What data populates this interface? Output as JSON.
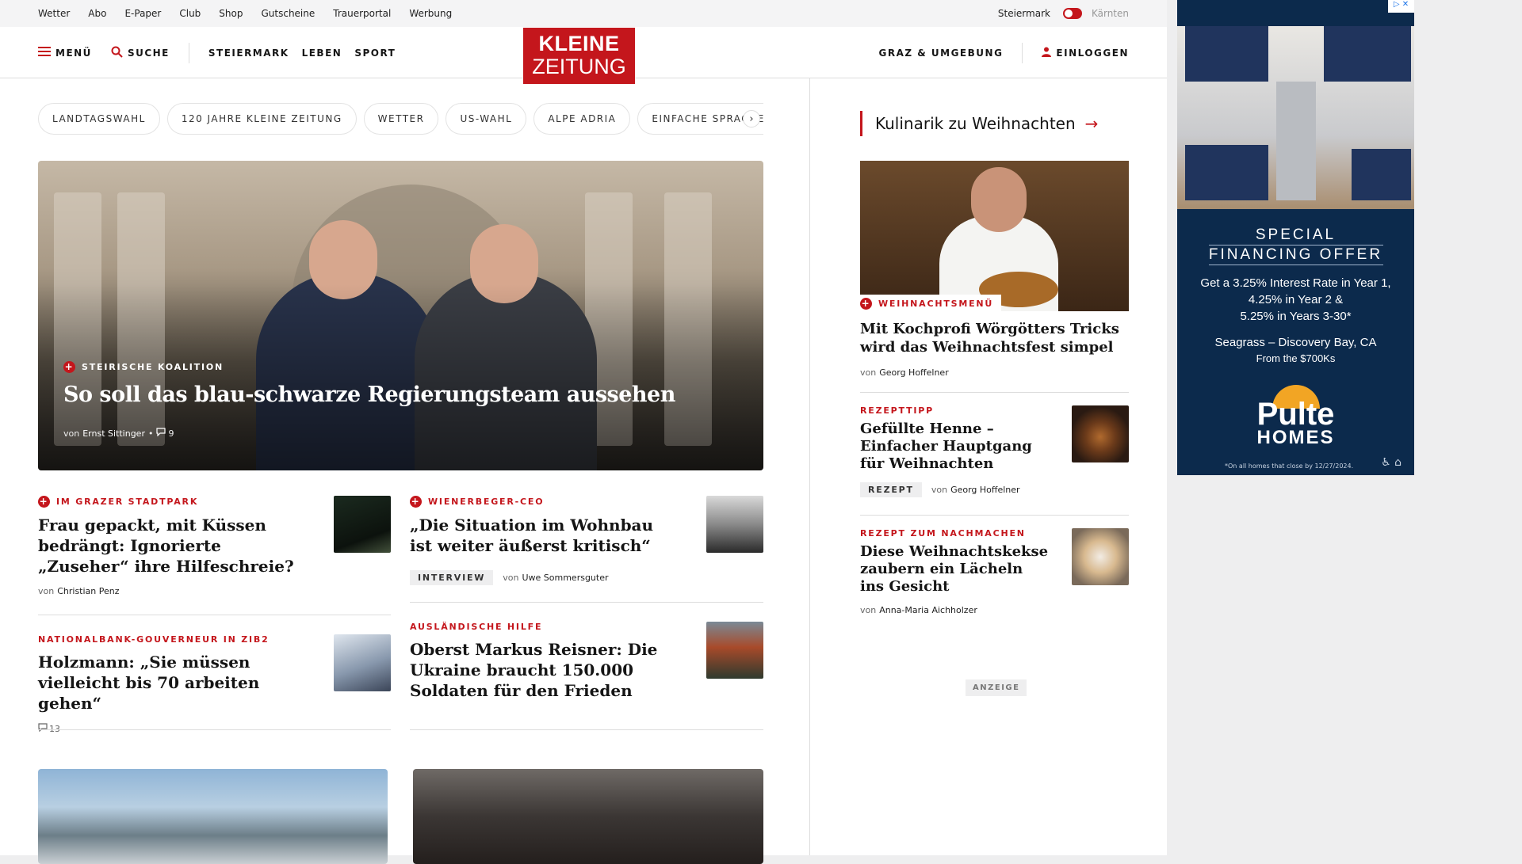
{
  "util_nav": [
    "Wetter",
    "Abo",
    "E-Paper",
    "Club",
    "Shop",
    "Gutscheine",
    "Trauerportal",
    "Werbung"
  ],
  "region": {
    "active": "Steiermark",
    "inactive": "Kärnten"
  },
  "header": {
    "menu": "MENÜ",
    "search": "SUCHE",
    "nav": [
      "STEIERMARK",
      "LEBEN",
      "SPORT"
    ],
    "logo_line1": "KLEINE",
    "logo_line2": "ZEITUNG",
    "region_link": "GRAZ & UMGEBUNG",
    "login": "EINLOGGEN"
  },
  "chips": [
    "LANDTAGSWAHL",
    "120 JAHRE KLEINE ZEITUNG",
    "WETTER",
    "US-WAHL",
    "ALPE ADRIA",
    "EINFACHE SPRACHE"
  ],
  "hero": {
    "kicker": "STEIRISCHE KOALITION",
    "title": "So soll das blau-schwarze Regierungsteam aussehen",
    "by": "von",
    "author": "Ernst Sittinger",
    "comments": "9"
  },
  "articles": [
    {
      "kicker": "IM GRAZER STADTPARK",
      "title": "Frau gepackt, mit Küssen bedrängt: Ignorierte „Zuseher“ ihre Hilfeschreie?",
      "by": "von",
      "author": "Christian Penz"
    },
    {
      "kicker": "WIENERBEGER-CEO",
      "title": "„Die Situation im Wohnbau ist weiter äußerst kritisch“",
      "tag": "INTERVIEW",
      "by": "von",
      "author": "Uwe Sommersguter"
    },
    {
      "kicker": "NATIONALBANK-GOUVERNEUR IN ZIB2",
      "title": "Holzmann: „Sie müssen vielleicht bis 70 arbeiten gehen“",
      "comments": "13"
    },
    {
      "kicker": "AUSLÄNDISCHE HILFE",
      "title": "Oberst Markus Reisner: Die Ukraine braucht 150.000 Soldaten für den Frieden"
    }
  ],
  "sidebar": {
    "section_title": "Kulinarik zu Weihnachten",
    "lead": {
      "kicker": "WEIHNACHTSMENÜ",
      "title": "Mit Kochprofi Wörgötters Tricks wird das Weihnachtsfest simpel",
      "by": "von",
      "author": "Georg Hoffelner"
    },
    "items": [
      {
        "kicker": "REZEPTTIPP",
        "title": "Gefüllte Henne – Einfacher Hauptgang für Weihnachten",
        "tag": "REZEPT",
        "by": "von",
        "author": "Georg Hoffelner"
      },
      {
        "kicker": "REZEPT ZUM NACHMACHEN",
        "title": "Diese Weihnachtskekse zaubern ein Lächeln ins Gesicht",
        "by": "von",
        "author": "Anna-Maria Aichholzer"
      }
    ],
    "ad_label": "ANZEIGE"
  },
  "ad": {
    "line1": "SPECIAL",
    "line2": "FINANCING OFFER",
    "rates": [
      "Get a 3.25% Interest Rate in Year 1,",
      "4.25% in Year 2 &",
      "5.25% in Years 3-30*"
    ],
    "location": "Seagrass – Discovery Bay, CA",
    "price": "From the $700Ks",
    "brand1": "Pulte",
    "brand2": "HOMES",
    "fine": "*On all homes that close by 12/27/2024."
  },
  "colors": {
    "brand_red": "#c4161c",
    "ad_navy": "#0c2a4c"
  }
}
